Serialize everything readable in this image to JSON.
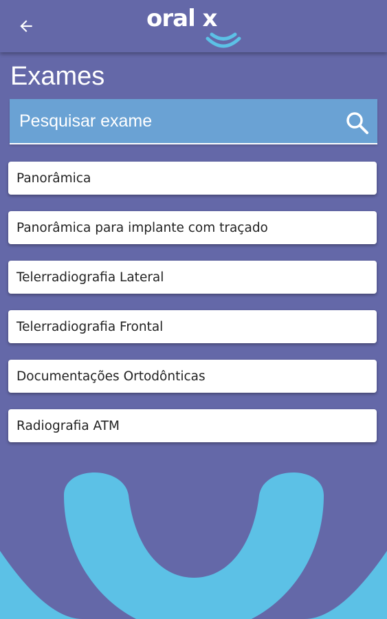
{
  "header": {
    "back_icon": "arrow-left-icon",
    "logo_text": "oral x"
  },
  "page": {
    "title": "Exames"
  },
  "search": {
    "placeholder": "Pesquisar exame",
    "value": "",
    "icon": "search-icon"
  },
  "exams": [
    {
      "label": "Panorâmica"
    },
    {
      "label": "Panorâmica para implante com traçado"
    },
    {
      "label": "Telerradiografia Lateral"
    },
    {
      "label": "Telerradiografia Frontal"
    },
    {
      "label": "Documentações Ortodônticas"
    },
    {
      "label": "Radiografia ATM"
    }
  ],
  "colors": {
    "background": "#6468a8",
    "search_bar": "#6aa2d4",
    "accent": "#5cc1e6",
    "card": "#ffffff"
  }
}
